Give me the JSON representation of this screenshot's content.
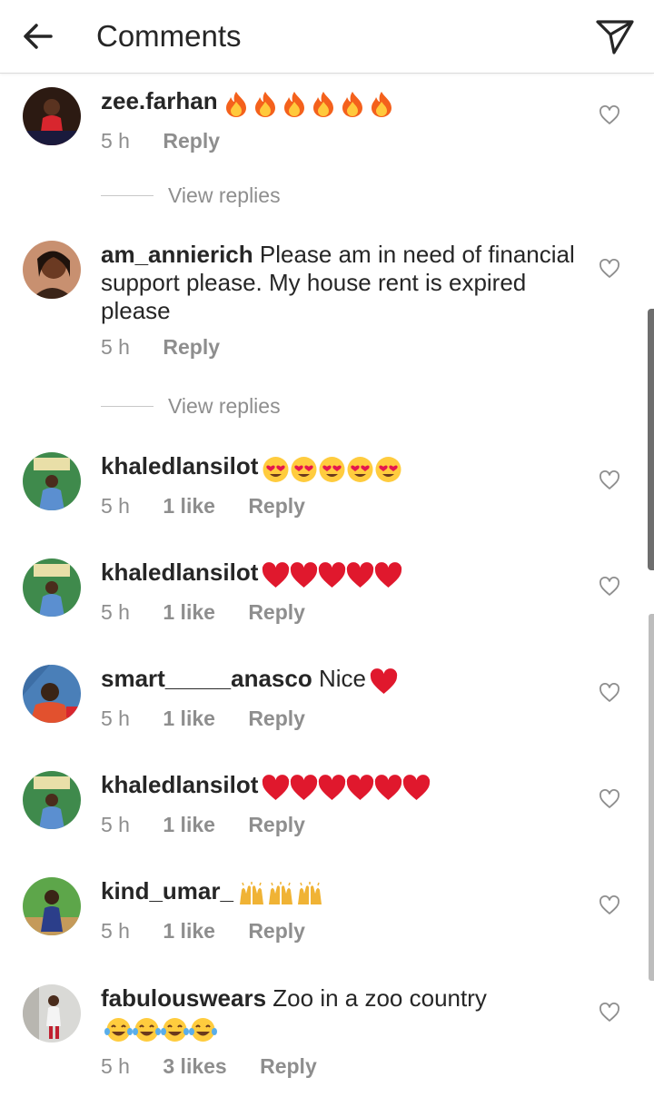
{
  "header": {
    "title": "Comments",
    "back_icon": "arrow-left-icon",
    "send_icon": "paper-plane-icon"
  },
  "comments": [
    {
      "username": "zee.farhan",
      "text": "",
      "emoji": "fire",
      "emoji_count": 6,
      "time": "5 h",
      "likes": "",
      "reply": "Reply"
    },
    {
      "username": "am_annierich",
      "text": "Please am in need of financial support please. My house rent is expired please",
      "time": "5 h",
      "likes": "",
      "reply": "Reply"
    },
    {
      "username": "khaledlansilot",
      "text": "",
      "emoji": "heart-eyes",
      "emoji_count": 5,
      "time": "5 h",
      "likes": "1 like",
      "reply": "Reply"
    },
    {
      "username": "khaledlansilot",
      "text": "",
      "emoji": "red-heart",
      "emoji_count": 5,
      "time": "5 h",
      "likes": "1 like",
      "reply": "Reply"
    },
    {
      "username": "smart_____anasco",
      "text": "Nice",
      "emoji": "red-heart",
      "emoji_count": 1,
      "time": "5 h",
      "likes": "1 like",
      "reply": "Reply"
    },
    {
      "username": "khaledlansilot",
      "text": "",
      "emoji": "red-heart",
      "emoji_count": 6,
      "time": "5 h",
      "likes": "1 like",
      "reply": "Reply"
    },
    {
      "username": "kind_umar_",
      "text": "",
      "emoji": "raised-hands",
      "emoji_count": 3,
      "time": "5 h",
      "likes": "1 like",
      "reply": "Reply"
    },
    {
      "username": "fabulouswears",
      "text": "Zoo in a zoo country",
      "emoji": "tears-of-joy",
      "emoji_count": 4,
      "time": "5 h",
      "likes": "3 likes",
      "reply": "Reply"
    }
  ],
  "view_replies": [
    "View replies",
    "View replies"
  ],
  "colors": {
    "text": "#262626",
    "secondary": "#8e8e8e",
    "divider": "#dbdbdb"
  }
}
